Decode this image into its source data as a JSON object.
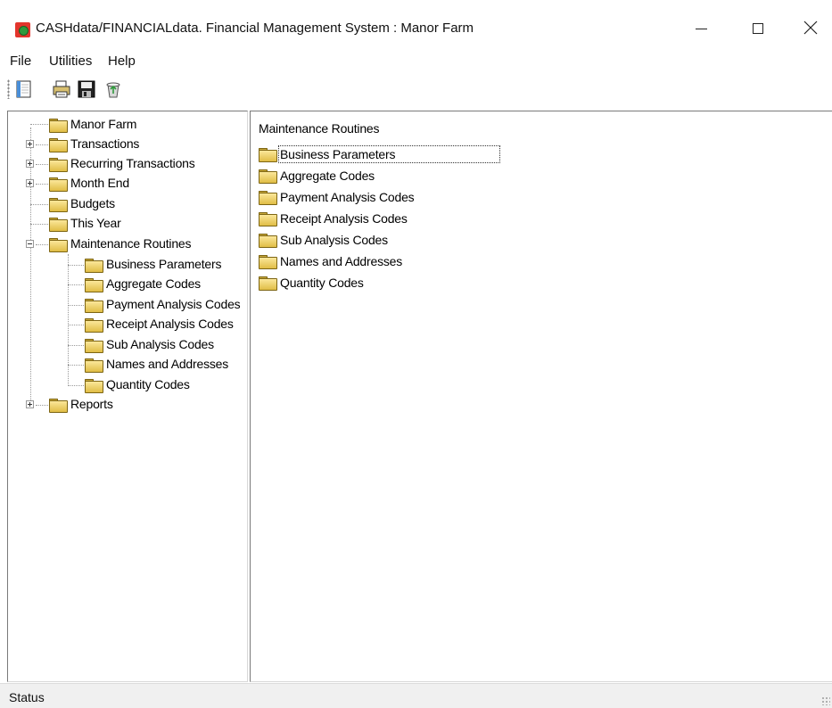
{
  "window": {
    "title": "CASHdata/FINANCIALdata. Financial Management System : Manor Farm"
  },
  "menu": {
    "items": [
      "File",
      "Utilities",
      "Help"
    ]
  },
  "toolbar": {
    "buttons": [
      "new-icon",
      "print-icon",
      "save-icon",
      "recycle-icon"
    ]
  },
  "tree": {
    "root": "Manor Farm",
    "nodes": [
      {
        "label": "Transactions",
        "expander": "plus"
      },
      {
        "label": "Recurring Transactions",
        "expander": "plus"
      },
      {
        "label": "Month End",
        "expander": "plus"
      },
      {
        "label": "Budgets",
        "expander": "none"
      },
      {
        "label": "This Year",
        "expander": "none"
      },
      {
        "label": "Maintenance Routines",
        "expander": "minus",
        "open": true
      },
      {
        "label": "Reports",
        "expander": "plus"
      }
    ],
    "children": [
      "Business Parameters",
      "Aggregate Codes",
      "Payment Analysis Codes",
      "Receipt Analysis Codes",
      "Sub Analysis Codes",
      "Names and Addresses",
      "Quantity Codes"
    ]
  },
  "list": {
    "header": "Maintenance Routines",
    "items": [
      "Business Parameters",
      "Aggregate Codes",
      "Payment Analysis Codes",
      "Receipt Analysis Codes",
      "Sub Analysis Codes",
      "Names and Addresses",
      "Quantity Codes"
    ],
    "focused_index": 0
  },
  "status": {
    "text": "Status"
  },
  "colors": {
    "app_icon_red": "#e3352c",
    "app_icon_green": "#2f9a3c",
    "folder_fill": "#f3d46a",
    "status_bar": "#f0f0f0"
  }
}
